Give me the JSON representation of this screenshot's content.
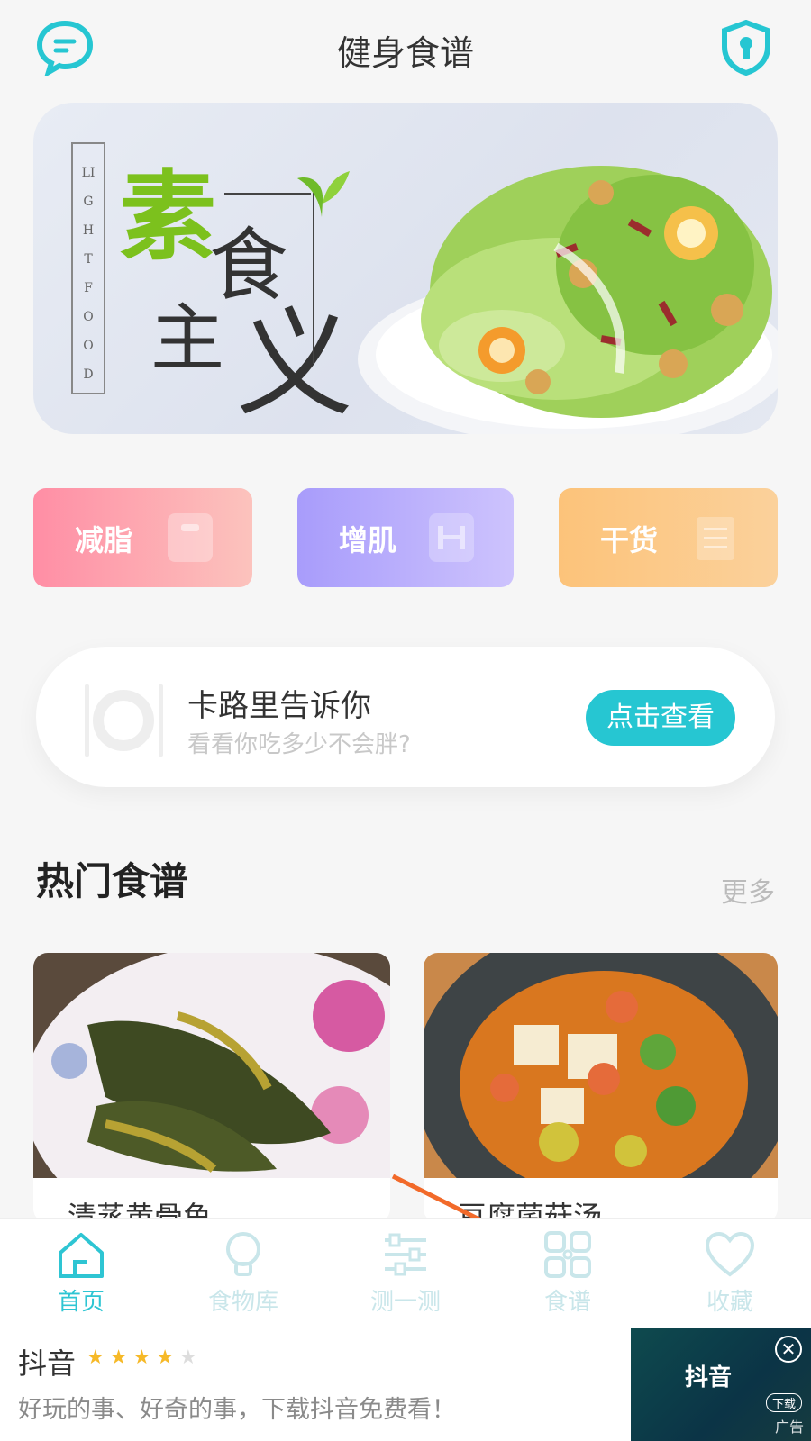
{
  "header": {
    "title": "健身食谱",
    "left_icon": "chat-icon",
    "right_icon": "shield-lock-icon"
  },
  "banner": {
    "title_chars": [
      "素",
      "食",
      "主",
      "义"
    ],
    "subtitle": "LIGHT FOOD"
  },
  "categories": [
    {
      "label": "减脂",
      "icon": "scale-icon",
      "color": "#ff8ea5"
    },
    {
      "label": "增肌",
      "icon": "dumbbell-icon",
      "color": "#a89cfb"
    },
    {
      "label": "干货",
      "icon": "notepad-icon",
      "color": "#fcc37a"
    }
  ],
  "calorie_card": {
    "title": "卡路里告诉你",
    "subtitle": "看看你吃多少不会胖?",
    "button": "点击查看"
  },
  "hot_section": {
    "title": "热门食谱",
    "more": "更多"
  },
  "recipes": [
    {
      "name": "清蒸黄骨鱼"
    },
    {
      "name": "豆腐菌菇汤"
    }
  ],
  "tabbar": [
    {
      "label": "首页",
      "icon": "home-icon",
      "active": true
    },
    {
      "label": "食物库",
      "icon": "lightbulb-icon",
      "active": false
    },
    {
      "label": "测一测",
      "icon": "sliders-icon",
      "active": false
    },
    {
      "label": "食谱",
      "icon": "grid-icon",
      "active": false
    },
    {
      "label": "收藏",
      "icon": "heart-icon",
      "active": false
    }
  ],
  "ad": {
    "title": "抖音",
    "rating": 4,
    "rating_max": 5,
    "description": "好玩的事、好奇的事，下载抖音免费看！",
    "image_brand": "抖音",
    "download": "下载",
    "tag": "广告"
  },
  "colors": {
    "accent": "#26c6d2",
    "tab_active": "#2ec5d3",
    "tab_inactive": "#c9e6ea",
    "brand_green": "#7cc11d"
  }
}
